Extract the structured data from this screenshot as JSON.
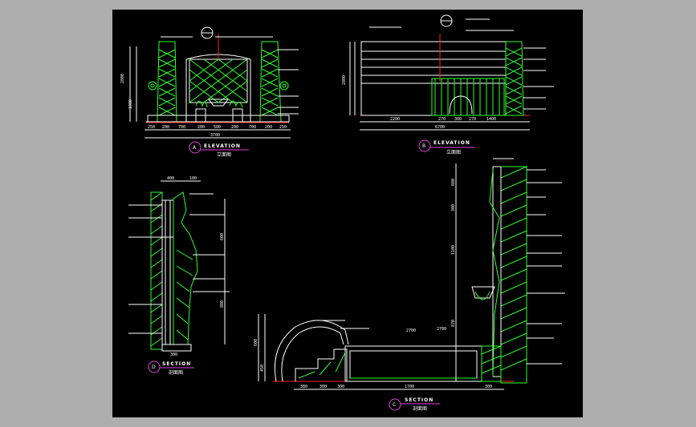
{
  "views": {
    "a": {
      "letter": "A",
      "title": "ELEVATION",
      "subtitle": "立面图"
    },
    "b": {
      "letter": "B",
      "title": "ELEVATION",
      "subtitle": "立面图"
    },
    "c": {
      "letter": "C",
      "title": "SECTION",
      "subtitle": "剖面图"
    },
    "d": {
      "letter": "D",
      "title": "SECTION",
      "subtitle": "剖面图"
    }
  },
  "colors": {
    "background": "#000000",
    "frame": "#aeaeae",
    "line_green": "#2bff2b",
    "line_white": "#ffffff",
    "line_yellow": "#ffff33",
    "line_red": "#ff2020",
    "accent_magenta": "#e040e0"
  },
  "dims": {
    "a_total": "3700",
    "b_total": "6700",
    "b_left": "2200",
    "c_bottom": "1700",
    "c_mid": "2700"
  }
}
